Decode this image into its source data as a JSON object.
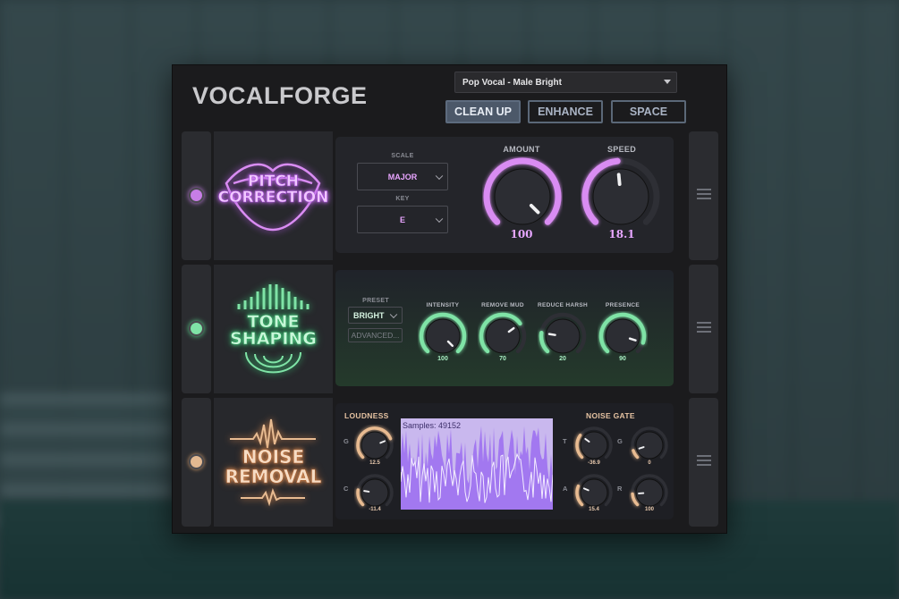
{
  "app": {
    "title": "VOCALFORGE"
  },
  "preset": {
    "selected": "Pop Vocal - Male Bright"
  },
  "tabs": [
    {
      "label": "CLEAN UP",
      "active": true
    },
    {
      "label": "ENHANCE",
      "active": false
    },
    {
      "label": "SPACE",
      "active": false
    }
  ],
  "colors": {
    "pitch": "#d98cf2",
    "tone": "#7fe3a6",
    "noise": "#e8bb91",
    "waveform": "#9b6cf0"
  },
  "pitch": {
    "logo_line1": "PITCH",
    "logo_line2": "CORRECTION",
    "scale_label": "SCALE",
    "scale_value": "MAJOR",
    "key_label": "KEY",
    "key_value": "E",
    "amount_label": "AMOUNT",
    "amount_value": "100",
    "amount_fraction": 1.0,
    "speed_label": "SPEED",
    "speed_value": "18.1",
    "speed_fraction": 0.48
  },
  "tone": {
    "logo_line1": "TONE",
    "logo_line2": "SHAPING",
    "preset_label": "PRESET",
    "preset_value": "BRIGHT",
    "advanced_label": "ADVANCED...",
    "knobs": [
      {
        "label": "INTENSITY",
        "value": "100",
        "fraction": 1.0
      },
      {
        "label": "REMOVE MUD",
        "value": "70",
        "fraction": 0.7
      },
      {
        "label": "REDUCE HARSH",
        "value": "20",
        "fraction": 0.2
      },
      {
        "label": "PRESENCE",
        "value": "90",
        "fraction": 0.9
      }
    ]
  },
  "noise": {
    "logo_line1": "NOISE",
    "logo_line2": "REMOVAL",
    "loudness_label": "LOUDNESS",
    "noise_gate_label": "NOISE GATE",
    "waveform_label": "Samples: 49152",
    "loudness_knobs": [
      {
        "letter": "G",
        "value": "12.5",
        "fraction": 0.75
      },
      {
        "letter": "C",
        "value": "-11.4",
        "fraction": 0.2
      }
    ],
    "gate_knobs": [
      {
        "letter": "T",
        "value": "-36.9",
        "fraction": 0.3
      },
      {
        "letter": "G",
        "value": "0",
        "fraction": 0.1
      },
      {
        "letter": "A",
        "value": "15.4",
        "fraction": 0.25
      },
      {
        "letter": "R",
        "value": "100",
        "fraction": 0.15
      }
    ]
  }
}
